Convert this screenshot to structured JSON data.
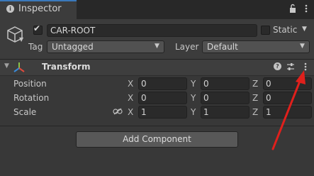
{
  "window": {
    "tab_title": "Inspector",
    "tab_icon": "info-icon"
  },
  "header": {
    "active": true,
    "name": "CAR-ROOT",
    "static_label": "Static",
    "static_checked": false,
    "tag_label": "Tag",
    "tag_value": "Untagged",
    "layer_label": "Layer",
    "layer_value": "Default"
  },
  "transform": {
    "title": "Transform",
    "rows": [
      {
        "label": "Position",
        "x": "0",
        "y": "0",
        "z": "0"
      },
      {
        "label": "Rotation",
        "x": "0",
        "y": "0",
        "z": "0"
      },
      {
        "label": "Scale",
        "x": "1",
        "y": "1",
        "z": "1"
      }
    ],
    "axes": {
      "x": "X",
      "y": "Y",
      "z": "Z"
    }
  },
  "add_component_label": "Add Component",
  "colors": {
    "accent": "#3a79bb",
    "annotation": "#e0201c",
    "background": "#383838"
  }
}
